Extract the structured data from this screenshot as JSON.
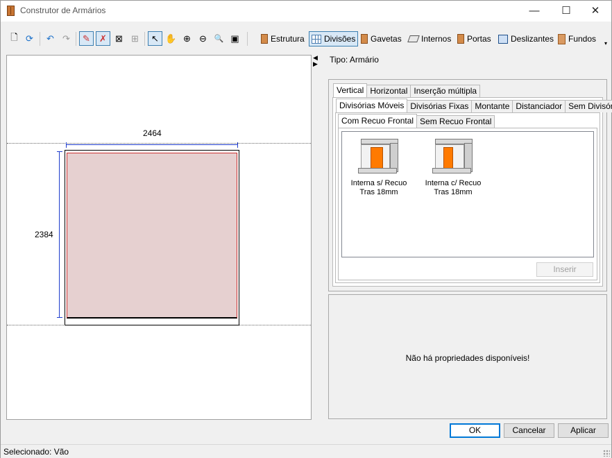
{
  "window": {
    "title": "Construtor de Armários",
    "controls": {
      "minimize": "—",
      "maximize": "☐",
      "close": "✕"
    }
  },
  "toolbar": {
    "icon_buttons": [
      {
        "name": "new-icon",
        "glyph": "🗋"
      },
      {
        "name": "refresh-icon",
        "glyph": "⟳"
      },
      {
        "name": "undo-icon",
        "glyph": "↶"
      },
      {
        "name": "redo-icon",
        "glyph": "↷"
      },
      {
        "name": "draw-edit-icon",
        "glyph": "✎"
      },
      {
        "name": "draw-cross-icon",
        "glyph": "✗"
      },
      {
        "name": "mirror-icon",
        "glyph": "⊠"
      },
      {
        "name": "grid-layout-icon",
        "glyph": "⊞"
      },
      {
        "name": "pointer-icon",
        "glyph": "↖"
      },
      {
        "name": "pan-hand-icon",
        "glyph": "✋"
      },
      {
        "name": "zoom-in-icon",
        "glyph": "⊕"
      },
      {
        "name": "zoom-out-icon",
        "glyph": "⊖"
      },
      {
        "name": "zoom-fit-icon",
        "glyph": "🔍"
      },
      {
        "name": "frame-icon",
        "glyph": "▣"
      }
    ],
    "sections": [
      "Estrutura",
      "Divisões",
      "Gavetas",
      "Internos",
      "Portas",
      "Deslizantes",
      "Fundos"
    ],
    "selected_section": "Divisões",
    "overflow": "▾"
  },
  "canvas": {
    "width_label": "2464",
    "height_label": "2384"
  },
  "splitter": {
    "collapse": "◀",
    "expand": "▶"
  },
  "right_panel": {
    "type_label": "Tipo: Armário",
    "orientation_tabs": [
      "Vertical",
      "Horizontal",
      "Inserção múltipla"
    ],
    "division_tabs": [
      "Divisórias Móveis",
      "Divisórias Fixas",
      "Montante",
      "Distanciador",
      "Sem Divisória"
    ],
    "recess_tabs": [
      "Com Recuo Frontal",
      "Sem Recuo Frontal"
    ],
    "items": [
      {
        "line1": "Interna s/ Recuo",
        "line2": "Tras 18mm"
      },
      {
        "line1": "Interna c/ Recuo",
        "line2": "Tras 18mm"
      }
    ],
    "insert_button": "Inserir",
    "no_properties": "Não há propriedades disponíveis!"
  },
  "dialog_buttons": {
    "ok": "OK",
    "cancel": "Cancelar",
    "apply": "Aplicar"
  },
  "status": {
    "selected": "Selecionado: Vão"
  }
}
